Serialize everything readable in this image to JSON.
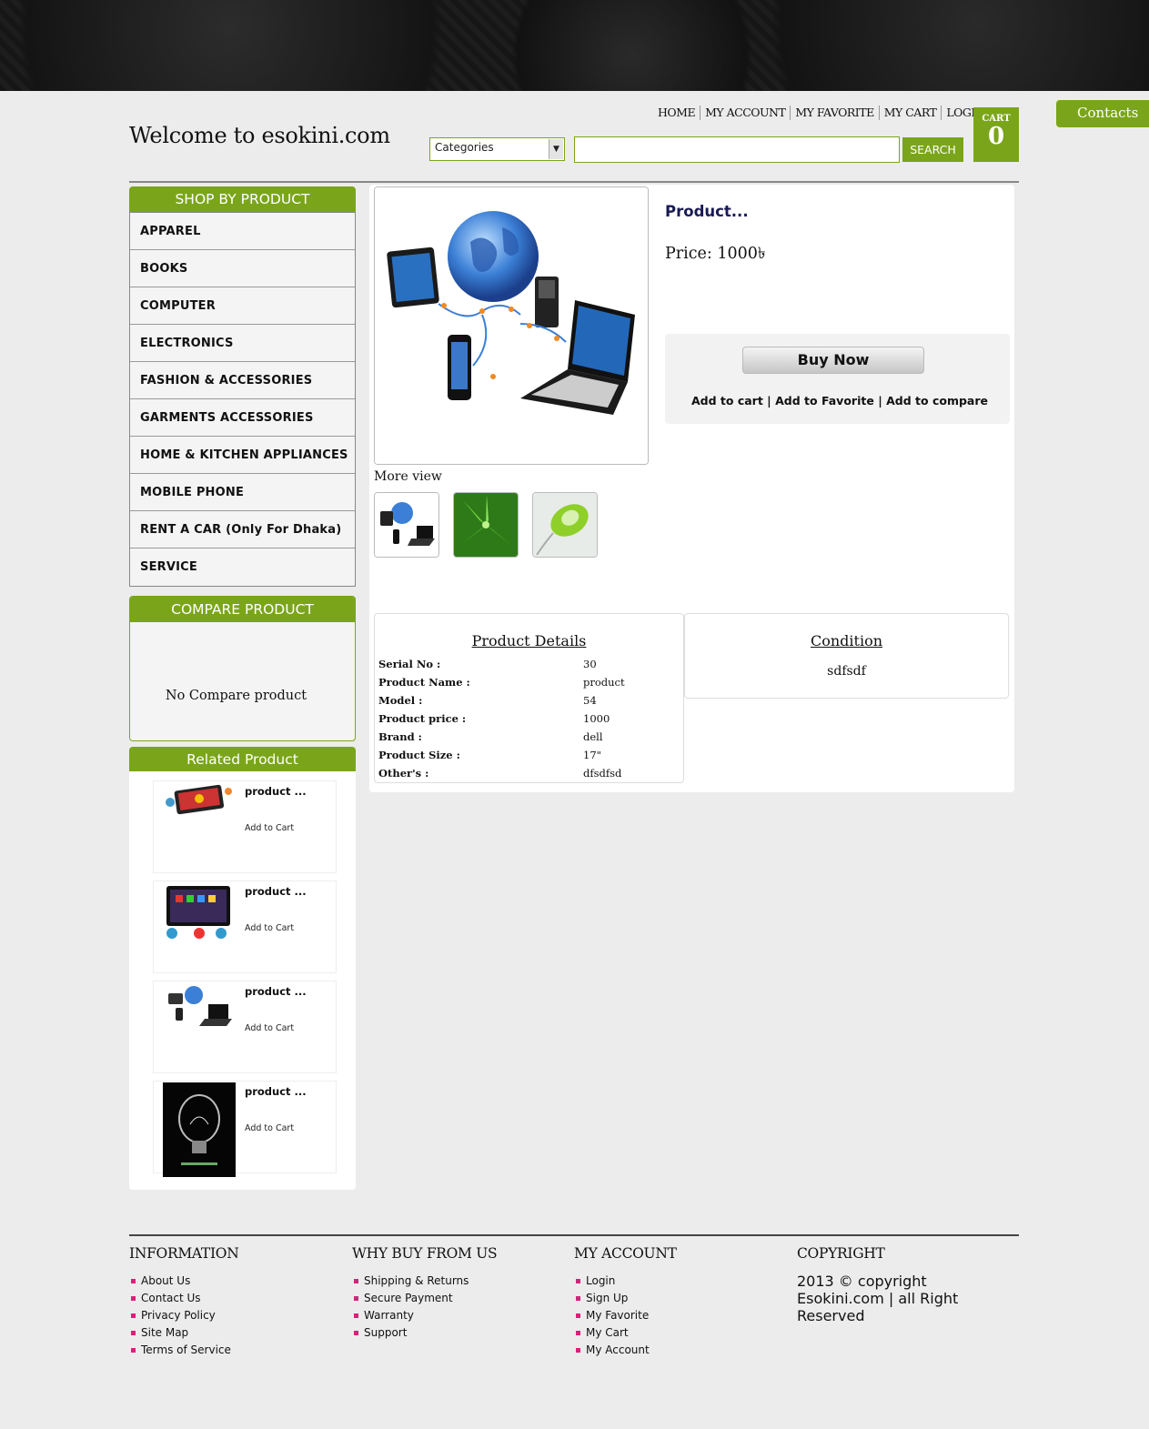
{
  "header": {
    "welcome": "Welcome to esokini.com",
    "nav": [
      "HOME",
      "MY ACCOUNT",
      "MY FAVORITE",
      "MY CART",
      "LOGIN"
    ],
    "category_select": "Categories",
    "search_placeholder": "",
    "search_label": "SEARCH",
    "cart_label": "CART",
    "cart_count": "0",
    "contacts_tab": "Contacts"
  },
  "sidebar": {
    "shop_title": "SHOP BY PRODUCT",
    "categories": [
      "APPAREL",
      "BOOKS",
      "COMPUTER",
      "ELECTRONICS",
      "FASHION & ACCESSORIES",
      "GARMENTS ACCESSORIES",
      "HOME & KITCHEN APPLIANCES",
      "MOBILE PHONE",
      "RENT A CAR (Only For Dhaka)",
      "SERVICE"
    ],
    "compare_title": "COMPARE PRODUCT",
    "compare_empty": "No Compare product",
    "related_title": "Related Product",
    "related": [
      {
        "name": "product ...",
        "action": "Add to Cart"
      },
      {
        "name": "product ...",
        "action": "Add to Cart"
      },
      {
        "name": "product ...",
        "action": "Add to Cart"
      },
      {
        "name": "product ...",
        "action": "Add to Cart"
      }
    ]
  },
  "product": {
    "title": "Product...",
    "price": "Price: 1000৳",
    "more_view": "More view",
    "buy_now": "Buy Now",
    "add_to_cart": "Add to cart",
    "add_to_favorite": "Add to Favorite",
    "add_to_compare": "Add to compare",
    "separator": "|",
    "details_title": "Product Details",
    "details": [
      {
        "k": "Serial No :",
        "v": "30"
      },
      {
        "k": "Product Name :",
        "v": "product"
      },
      {
        "k": "Model :",
        "v": "54"
      },
      {
        "k": "Product price :",
        "v": "1000"
      },
      {
        "k": "Brand :",
        "v": "dell"
      },
      {
        "k": "Product Size :",
        "v": "17\""
      },
      {
        "k": "Other's :",
        "v": "dfsdfsd"
      }
    ],
    "condition_title": "Condition",
    "condition": "sdfsdf"
  },
  "footer": {
    "information": {
      "title": "INFORMATION",
      "links": [
        "About Us",
        "Contact Us",
        "Privacy Policy",
        "Site Map",
        "Terms of Service"
      ]
    },
    "why": {
      "title": "WHY BUY FROM US",
      "links": [
        "Shipping & Returns",
        "Secure Payment",
        "Warranty",
        "Support"
      ]
    },
    "account": {
      "title": "MY ACCOUNT",
      "links": [
        "Login",
        "Sign Up",
        "My Favorite",
        "My Cart",
        "My Account"
      ]
    },
    "copyright": {
      "title": "COPYRIGHT",
      "text": "2013 © copyright Esokini.com | all Right Reserved"
    }
  },
  "colors": {
    "accent": "#7aa51a",
    "bullet": "#d4237a",
    "title": "#1a1a55"
  }
}
